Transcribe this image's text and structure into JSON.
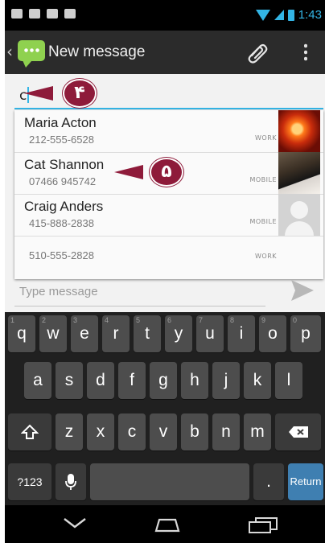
{
  "status_bar": {
    "time": "1:43",
    "left_icons": [
      "sms-notification-icon",
      "voicemail-icon",
      "download-icon",
      "download-icon"
    ],
    "right_icons": [
      "wifi-icon",
      "signal-icon",
      "battery-icon"
    ],
    "accent_color": "#33b5e5"
  },
  "action_bar": {
    "back_glyph": "‹",
    "title": "New message",
    "icons": [
      "messaging-app-icon",
      "paperclip-icon",
      "overflow-menu-icon"
    ]
  },
  "compose": {
    "to_value": "c",
    "message_placeholder": "Type message"
  },
  "suggestions": [
    {
      "name": "Maria Acton",
      "number": "212-555-6528",
      "type": "WORK"
    },
    {
      "name": "Cat Shannon",
      "number": "07466 945742",
      "type": "MOBILE"
    },
    {
      "name": "Craig Anders",
      "number": "415-888-2838",
      "type": "MOBILE"
    },
    {
      "name": "",
      "number": "510-555-2828",
      "type": "WORK"
    }
  ],
  "callouts": [
    {
      "label": "۴"
    },
    {
      "label": "۵"
    }
  ],
  "keyboard": {
    "row1": [
      "q",
      "w",
      "e",
      "r",
      "t",
      "y",
      "u",
      "i",
      "o",
      "p"
    ],
    "row1_hints": [
      "1",
      "2",
      "3",
      "4",
      "5",
      "6",
      "7",
      "8",
      "9",
      "0"
    ],
    "row2": [
      "a",
      "s",
      "d",
      "f",
      "g",
      "h",
      "j",
      "k",
      "l"
    ],
    "row3": [
      "z",
      "x",
      "c",
      "v",
      "b",
      "n",
      "m"
    ],
    "symbols_key": "?123",
    "period_key": ".",
    "return_key": "Return",
    "return_color": "#3f7fb1"
  },
  "nav_bar": {
    "icons": [
      "back-icon",
      "home-icon",
      "recent-apps-icon"
    ]
  }
}
